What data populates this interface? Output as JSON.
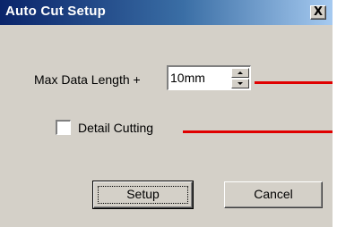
{
  "window": {
    "title": "Auto Cut Setup",
    "close_symbol": "X",
    "close_icon": "close-icon"
  },
  "max_data_length": {
    "label": "Max Data Length +",
    "value": "10mm"
  },
  "detail_cutting": {
    "label": "Detail Cutting",
    "checked": false
  },
  "buttons": {
    "setup_label": "Setup",
    "cancel_label": "Cancel"
  },
  "colors": {
    "titlebar_start": "#0a246a",
    "titlebar_end": "#a6caf0",
    "dialog_face": "#d4d0c8",
    "annotation_line": "#e00000"
  }
}
